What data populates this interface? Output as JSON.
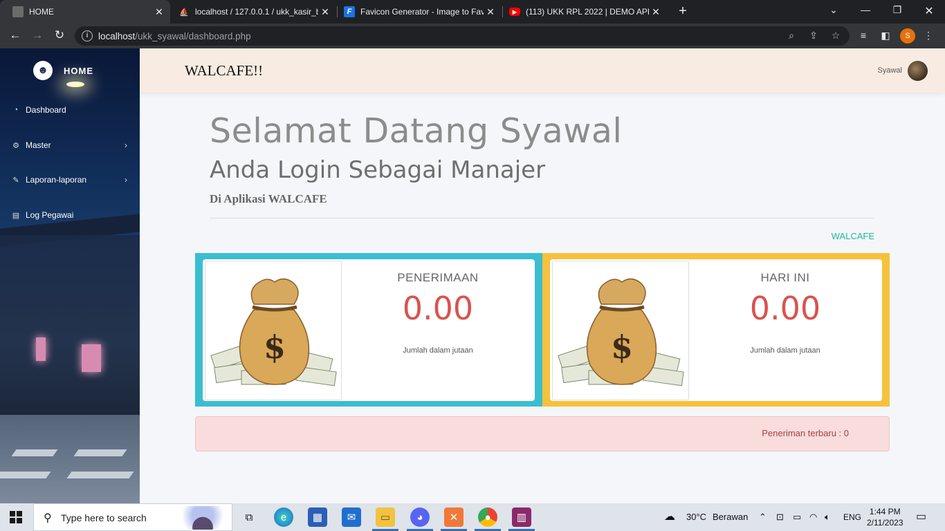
{
  "browser": {
    "tabs": [
      {
        "title": "HOME",
        "active": true,
        "favicon": "page-icon"
      },
      {
        "title": "localhost / 127.0.0.1 / ukk_kasir_b",
        "active": false,
        "favicon": "phpmyadmin-icon"
      },
      {
        "title": "Favicon Generator - Image to Fav",
        "active": false,
        "favicon": "favicon-generator-icon"
      },
      {
        "title": "(113) UKK RPL 2022 | DEMO APLIK",
        "active": false,
        "favicon": "youtube-icon"
      }
    ],
    "url_host": "localhost",
    "url_path": "/ukk_syawal/dashboard.php",
    "profile_initial": "S"
  },
  "sidebar": {
    "brand": "HOME",
    "items": [
      {
        "label": "Dashboard",
        "icon": "dashboard-icon",
        "has_submenu": false
      },
      {
        "label": "Master",
        "icon": "gear-icon",
        "has_submenu": true
      },
      {
        "label": "Laporan-laporan",
        "icon": "edit-icon",
        "has_submenu": true
      },
      {
        "label": "Log Pegawai",
        "icon": "clipboard-icon",
        "has_submenu": false
      }
    ]
  },
  "header": {
    "app_title": "WALCAFE!!",
    "user_name": "Syawal"
  },
  "main": {
    "welcome": "Selamat Datang Syawal",
    "role": "Anda Login Sebagai Manajer",
    "app_line": "Di Aplikasi WALCAFE",
    "brand_link": "WALCAFE",
    "cards": [
      {
        "label": "PENERIMAAN",
        "value": "0.00",
        "note": "Jumlah dalam jutaan",
        "color": "#3bbdd1"
      },
      {
        "label": "HARI INI",
        "value": "0.00",
        "note": "Jumlah dalam jutaan",
        "color": "#f6c13c"
      }
    ],
    "alert": "Peneriman terbaru : 0"
  },
  "taskbar": {
    "search_placeholder": "Type here to search",
    "weather_temp": "30°C",
    "weather_desc": "Berawan",
    "language": "ENG",
    "time": "1:44 PM",
    "date": "2/11/2023"
  }
}
